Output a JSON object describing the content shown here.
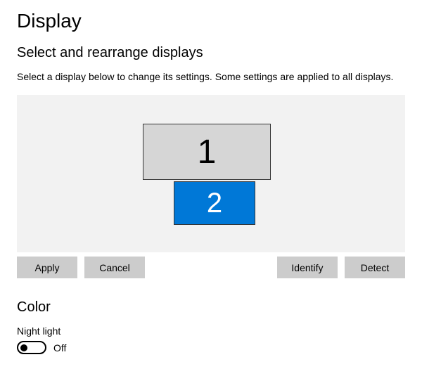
{
  "page": {
    "title": "Display"
  },
  "rearrange": {
    "title": "Select and rearrange displays",
    "description": "Select a display below to change its settings. Some settings are applied to all displays.",
    "displays": {
      "d1": "1",
      "d2": "2"
    },
    "buttons": {
      "apply": "Apply",
      "cancel": "Cancel",
      "identify": "Identify",
      "detect": "Detect"
    }
  },
  "color": {
    "title": "Color",
    "night_light_label": "Night light",
    "night_light_state": "Off"
  }
}
